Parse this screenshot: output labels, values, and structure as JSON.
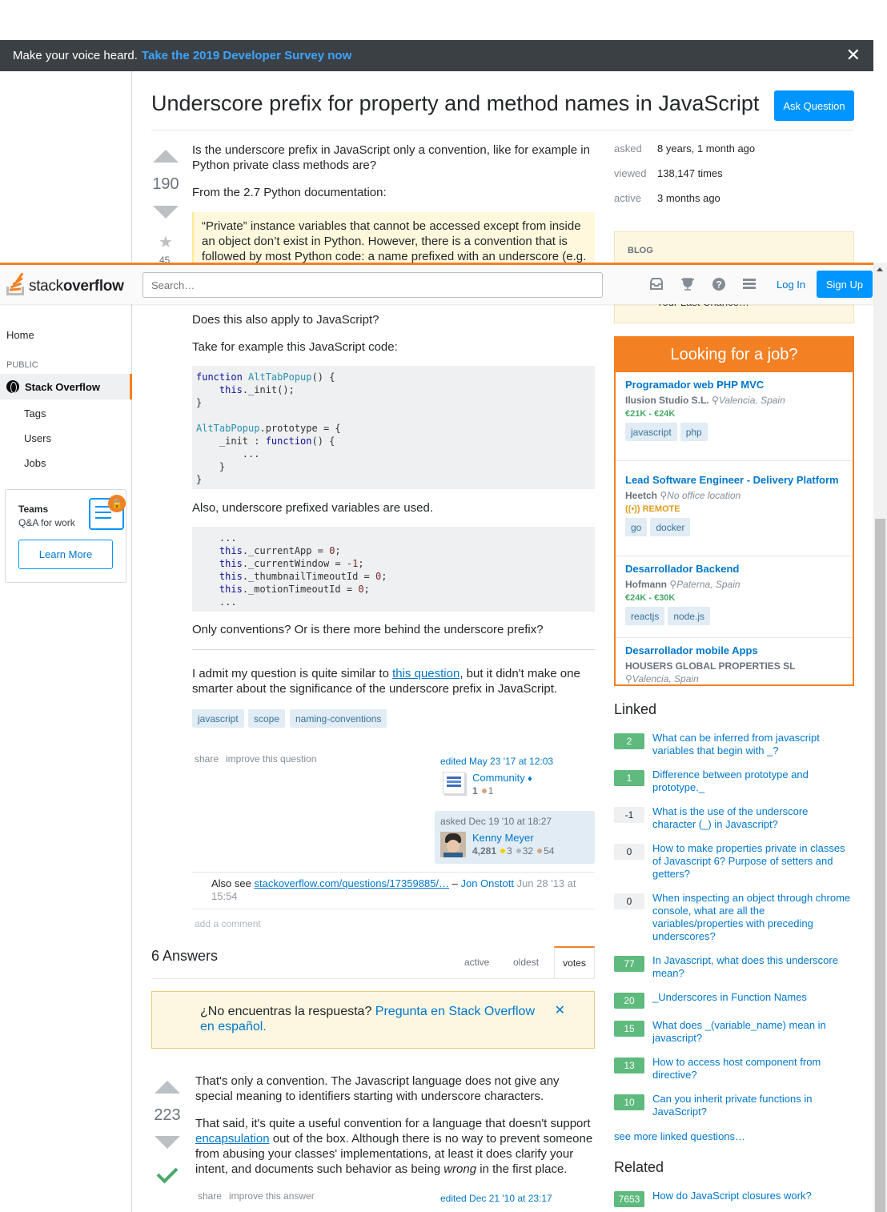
{
  "survey": {
    "lead": "Make your voice heard.",
    "link": "Take the 2019 Developer Survey now",
    "close": "✕"
  },
  "header": {
    "logo_a": "stack",
    "logo_b": "overflow",
    "search_placeholder": "Search…",
    "login": "Log In",
    "signup": "Sign Up"
  },
  "nav": {
    "home": "Home",
    "public": "PUBLIC",
    "stack_overflow": "Stack Overflow",
    "items": [
      "Tags",
      "Users",
      "Jobs"
    ],
    "teams_title": "Teams",
    "teams_sub": "Q&A for work",
    "teams_button": "Learn More"
  },
  "question": {
    "title": "Underscore prefix for property and method names in JavaScript",
    "ask_button": "Ask Question",
    "votes": "190",
    "favorites": "45",
    "p1": "Is the underscore prefix in JavaScript only a convention, like for example in Python private class methods are?",
    "p2": "From the 2.7 Python documentation:",
    "quote": "“Private” instance variables that cannot be accessed except from inside an object don’t exist in Python. However, there is a convention that is followed by most Python code: a name prefixed with an underscore (e.g.",
    "p3": "Does this also apply to JavaScript?",
    "p4": "Take for example this JavaScript code:",
    "p5": "Also, underscore prefixed variables are used.",
    "p6": "Only conventions? Or is there more behind the underscore prefix?",
    "p7a": "I admit my question is quite similar to ",
    "p7link": "this question",
    "p7b": ", but it didn't make one smarter about the significance of the underscore prefix in JavaScript.",
    "tags": [
      "javascript",
      "scope",
      "naming-conventions"
    ],
    "share": "share",
    "improve": "improve this question",
    "edited": "edited May 23 '17 at 12:03",
    "editor_name": "Community",
    "editor_mod": "♦",
    "editor_rep": "1",
    "editor_bronze": "1",
    "asked": "asked Dec 19 '10 at 18:27",
    "asker_name": "Kenny Meyer",
    "asker_rep": "4,281",
    "asker_gold": "3",
    "asker_silver": "32",
    "asker_bronze": "54",
    "comment_pre": "Also see ",
    "comment_link": "stackoverflow.com/questions/17359885/…",
    "comment_sep": " – ",
    "comment_user": "Jon Onstott",
    "comment_date": " Jun 28 '13 at 15:54",
    "add_comment": "add a comment"
  },
  "answers": {
    "count_label": "6 Answers",
    "tabs": [
      "active",
      "oldest",
      "votes"
    ],
    "notice_a": "¿No encuentras la respuesta? ",
    "notice_link": "Pregunta en Stack Overflow en español.",
    "notice_close": "✕",
    "top": {
      "votes": "223",
      "p1": "That's only a convention. The Javascript language does not give any special meaning to identifiers starting with underscore characters.",
      "p2a": "That said, it's quite a useful convention for a language that doesn't support ",
      "p2link": "encapsulation",
      "p2b": " out of the box. Although there is no way to prevent someone from abusing your classes' implementations, at least it does clarify your intent, and documents such behavior as being ",
      "p2em": "wrong",
      "p2c": " in the first place.",
      "share": "share",
      "improve": "improve this answer",
      "edited": "edited Dec 21 '10 at 23:17"
    }
  },
  "stats": {
    "asked_label": "asked",
    "asked_value": "8 years, 1 month ago",
    "viewed_label": "viewed",
    "viewed_value": "138,147 times",
    "active_label": "active",
    "active_value": "3 months ago"
  },
  "blog": {
    "heading": "BLOG",
    "item": "Your Last Chance…"
  },
  "jobs": {
    "heading": "Looking for a job?",
    "list": [
      {
        "title": "Programador web PHP MVC",
        "company": "Ilusion Studio S.L.",
        "location": "Valencia, Spain",
        "salary": "€21K - €24K",
        "tags": [
          "javascript",
          "php"
        ]
      },
      {
        "title": "Lead Software Engineer - Delivery Platform",
        "company": "Heetch",
        "location": "No office location",
        "remote": "REMOTE",
        "tags": [
          "go",
          "docker"
        ]
      },
      {
        "title": "Desarrollador Backend",
        "company": "Hofmann",
        "location": "Paterna, Spain",
        "salary": "€24K - €30K",
        "tags": [
          "reactjs",
          "node.js"
        ]
      },
      {
        "title": "Desarrollador mobile Apps",
        "company": "HOUSERS GLOBAL PROPERTIES SL",
        "location": "Valencia, Spain"
      }
    ]
  },
  "linked": {
    "heading": "Linked",
    "items": [
      {
        "count": "2",
        "title": "What can be inferred from javascript variables that begin with _?"
      },
      {
        "count": "1",
        "title": "Difference between prototype and prototype._"
      },
      {
        "count": "-1",
        "title": "What is the use of the underscore character (_) in Javascript?"
      },
      {
        "count": "0",
        "title": "How to make properties private in classes of Javascript 6? Purpose of setters and getters?"
      },
      {
        "count": "0",
        "title": "When inspecting an object through chrome console, what are all the variables/properties with preceding underscores?"
      },
      {
        "count": "77",
        "title": "In Javascript, what does this underscore mean?"
      },
      {
        "count": "20",
        "title": "_Underscores in Function Names"
      },
      {
        "count": "15",
        "title": "What does _(variable_name) mean in javascript?"
      },
      {
        "count": "13",
        "title": "How to access host component from directive?"
      },
      {
        "count": "10",
        "title": "Can you inherit private functions in JavaScript?"
      }
    ],
    "more": "see more linked questions…"
  },
  "related": {
    "heading": "Related",
    "items": [
      {
        "count": "7653",
        "title": "How do JavaScript closures work?"
      }
    ]
  },
  "colors": {
    "accent": "#f48024",
    "link": "#0077cc",
    "primary_button": "#0095ff",
    "tag_bg": "#e1ecf4",
    "answered_green": "#5eba7d"
  }
}
